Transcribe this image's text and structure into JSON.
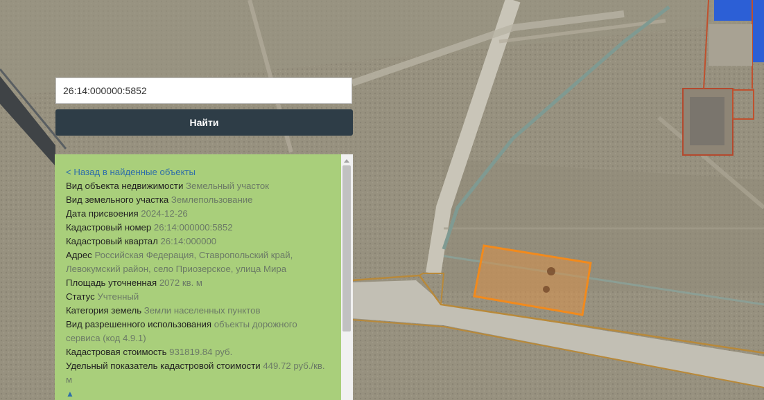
{
  "search": {
    "value": "26:14:000000:5852",
    "button_label": "Найти"
  },
  "panel": {
    "back_link": "< Назад в найденные объекты",
    "rows": [
      {
        "label": "Вид объекта недвижимости",
        "value": "Земельный участок"
      },
      {
        "label": "Вид земельного участка",
        "value": "Землепользование"
      },
      {
        "label": "Дата присвоения",
        "value": "2024-12-26"
      },
      {
        "label": "Кадастровый номер",
        "value": "26:14:000000:5852"
      },
      {
        "label": "Кадастровый квартал",
        "value": "26:14:000000"
      },
      {
        "label": "Адрес",
        "value": "Российская Федерация, Ставропольский край, Левокумский район, село Приозерское, улица Мира"
      },
      {
        "label": "Площадь уточненная",
        "value": "2072 кв. м"
      },
      {
        "label": "Статус",
        "value": "Учтенный"
      },
      {
        "label": "Категория земель",
        "value": "Земли населенных пунктов"
      },
      {
        "label": "Вид разрешенного использования",
        "value": "объекты дорожного сервиса (код 4.9.1)"
      },
      {
        "label": "Кадастровая стоимость",
        "value": "931819.84 руб."
      },
      {
        "label": "Удельный показатель кадастровой стоимости",
        "value": "449.72 руб./кв. м"
      }
    ],
    "scroll_up_glyph": "▲"
  },
  "map": {
    "parcel_highlight_color": "#f28a1c",
    "road_border_color": "#b8893a"
  }
}
